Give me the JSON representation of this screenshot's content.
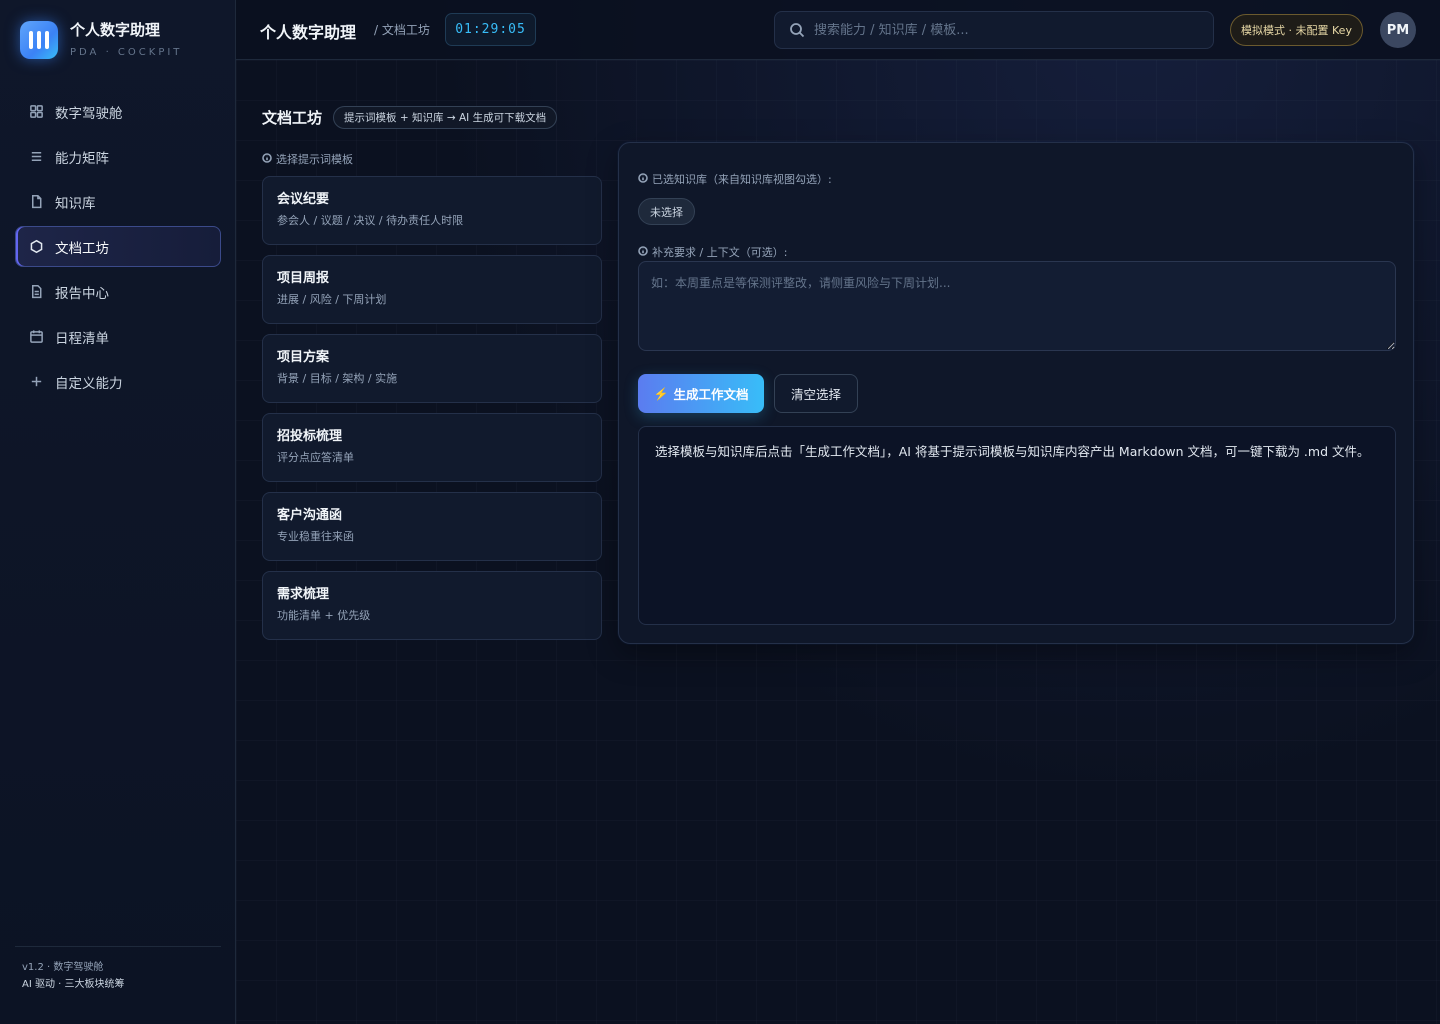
{
  "app": {
    "title": "个人数字助理",
    "subtitle": "PDA · COCKPIT"
  },
  "sidebar": {
    "items": [
      {
        "label": "数字驾驶舱",
        "icon": "grid-icon",
        "active": false
      },
      {
        "label": "能力矩阵",
        "icon": "list-icon",
        "active": false
      },
      {
        "label": "知识库",
        "icon": "file-icon",
        "active": false
      },
      {
        "label": "文档工坊",
        "icon": "hexagon-icon",
        "active": true
      },
      {
        "label": "报告中心",
        "icon": "report-icon",
        "active": false
      },
      {
        "label": "日程清单",
        "icon": "calendar-icon",
        "active": false
      },
      {
        "label": "自定义能力",
        "icon": "plus-icon",
        "active": false
      }
    ],
    "footer": {
      "version": "v1.2 · 数字驾驶舱",
      "tagline": "AI 驱动 · 三大板块统筹"
    }
  },
  "topbar": {
    "title": "个人数字助理",
    "breadcrumb": "/ 文档工坊",
    "clock": "01:29:05",
    "search_placeholder": "搜索能力 / 知识库 / 模板...",
    "mode_badge": "模拟模式 · 未配置 Key",
    "avatar": "PM"
  },
  "page": {
    "title": "文档工坊",
    "pill": "提示词模板 + 知识库 → AI 生成可下载文档"
  },
  "templates": {
    "label": "选择提示词模板",
    "items": [
      {
        "name": "会议纪要",
        "desc": "参会人 / 议题 / 决议 / 待办责任人时限"
      },
      {
        "name": "项目周报",
        "desc": "进展 / 风险 / 下周计划"
      },
      {
        "name": "项目方案",
        "desc": "背景 / 目标 / 架构 / 实施"
      },
      {
        "name": "招投标梳理",
        "desc": "评分点应答清单"
      },
      {
        "name": "客户沟通函",
        "desc": "专业稳重往来函"
      },
      {
        "name": "需求梳理",
        "desc": "功能清单 + 优先级"
      }
    ]
  },
  "panel": {
    "kb_label": "已选知识库（来自知识库视图勾选）:",
    "kb_chip": "未选择",
    "ctx_label": "补充要求 / 上下文（可选）:",
    "ctx_placeholder": "如：本周重点是等保测评整改，请侧重风险与下周计划...",
    "generate_label": "生成工作文档",
    "clear_label": "清空选择",
    "output_text": "选择模板与知识库后点击「生成工作文档」，AI 将基于提示词模板与知识库内容产出 Markdown 文档，可一键下载为 .md 文件。"
  },
  "colors": {
    "background": "#0b1120",
    "accent": "#38bdf8",
    "accent_secondary": "#5b7cf0",
    "mode_badge_border": "#6b5a2e"
  }
}
